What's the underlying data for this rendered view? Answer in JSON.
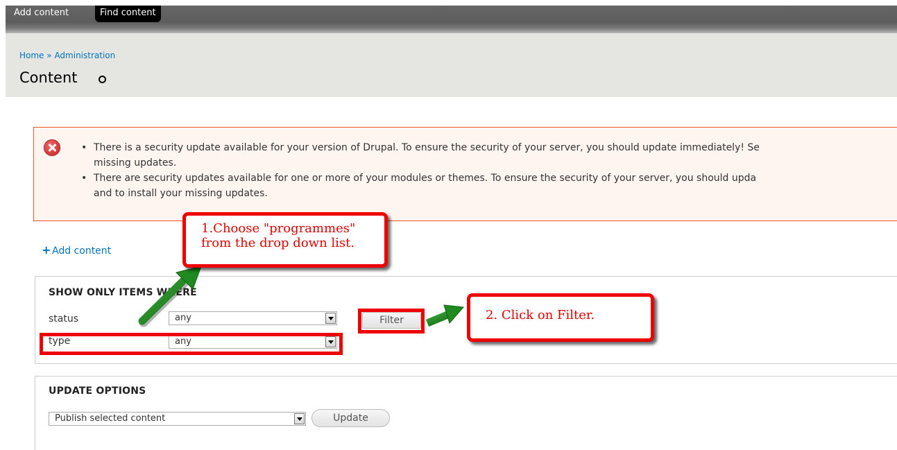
{
  "toolbar": {
    "add_content": "Add content",
    "find_content": "Find content"
  },
  "breadcrumb": {
    "home": "Home",
    "separator": "»",
    "administration": "Administration"
  },
  "page": {
    "title": "Content"
  },
  "messages": {
    "items": [
      "There is a security update available for your version of Drupal. To ensure the security of your server, you should update immediately! Se",
      "missing updates.",
      "There are security updates available for one or more of your modules or themes. To ensure the security of your server, you should upda",
      "and to install your missing updates."
    ]
  },
  "actions": {
    "add_content": "Add content"
  },
  "filter": {
    "legend": "SHOW ONLY ITEMS WHERE",
    "status_label": "status",
    "status_value": "any",
    "type_label": "type",
    "type_value": "any",
    "filter_button": "Filter"
  },
  "update": {
    "legend": "UPDATE OPTIONS",
    "operation_value": "Publish selected content",
    "update_button": "Update"
  },
  "annotations": {
    "note1_line1": "1.Choose \"programmes\"",
    "note1_line2": "from the drop down list.",
    "note2": "2. Click on Filter."
  },
  "colors": {
    "annotation_red": "#ee0000",
    "arrow_green": "#1f8a1f",
    "link_blue": "#0074bd",
    "error_border": "#ed541d"
  }
}
